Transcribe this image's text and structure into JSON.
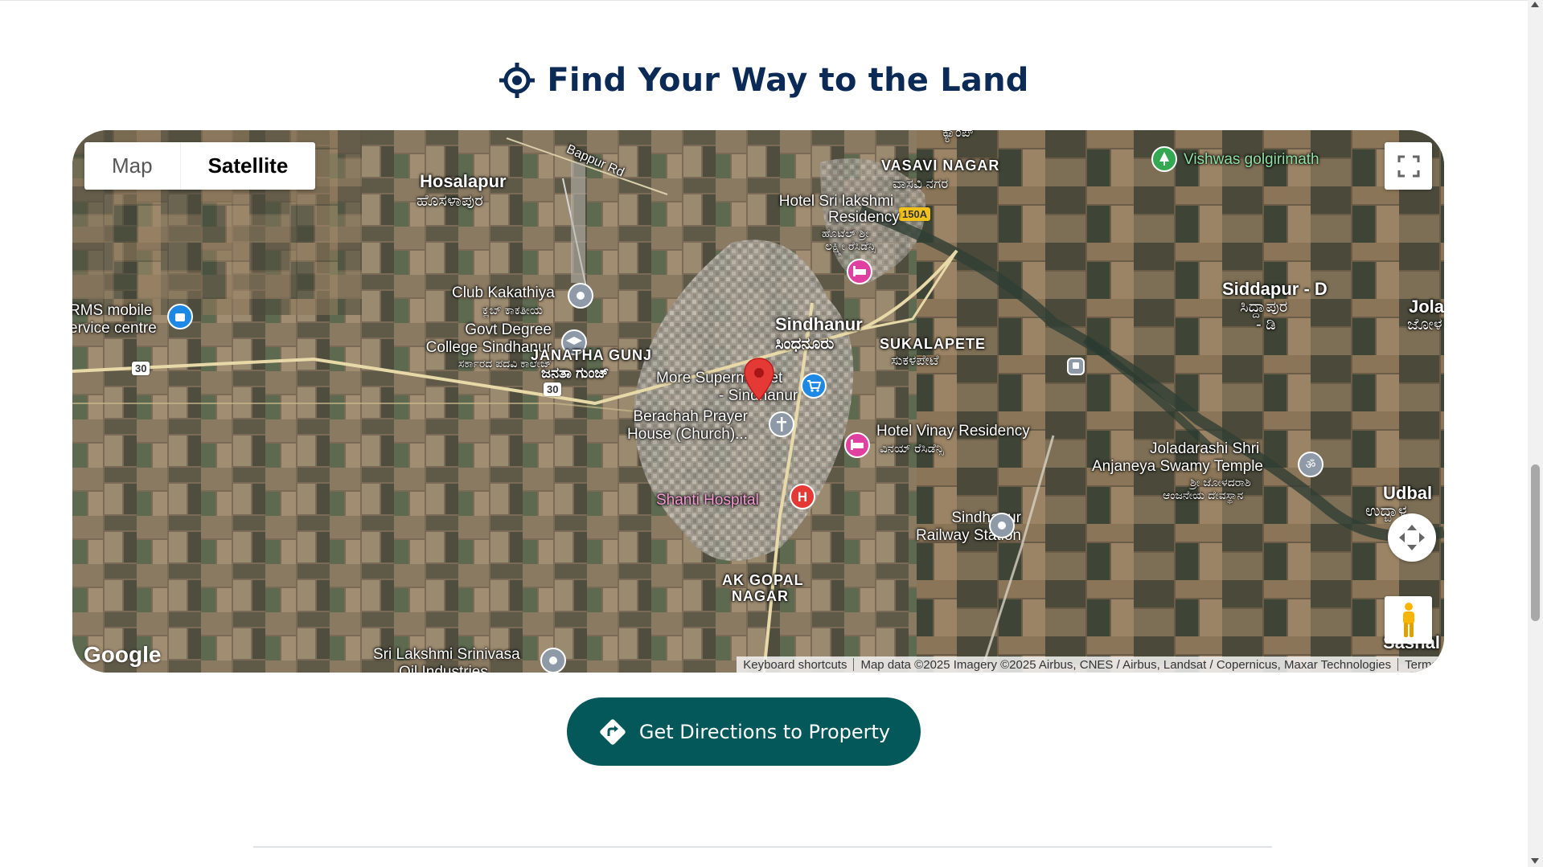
{
  "section": {
    "title": "Find Your Way to the Land",
    "title_icon": "crosshair-location-icon"
  },
  "map": {
    "type_control": {
      "map_label": "Map",
      "satellite_label": "Satellite",
      "selected": "Satellite"
    },
    "fullscreen_icon": "fullscreen-icon",
    "pan_icon": "pan-control-icon",
    "pegman_icon": "street-view-pegman-icon",
    "logo": "Google",
    "attribution": {
      "shortcuts": "Keyboard shortcuts",
      "data": "Map data ©2025 Imagery ©2025 Airbus, CNES / Airbus, Landsat / Copernicus, Maxar Technologies",
      "terms": "Terms"
    },
    "labels": {
      "hosalapur": "Hosalapur",
      "hosalapur_kn": "ಹೊಸಳಾಪುರ",
      "bappur_rd": "Bappur Rd",
      "vasavi_nagar": "VASAVI NAGAR",
      "vasavi_nagar_kn": "ವಾಸವಿ ನಗರ",
      "camp_kn": "ಕ್ಯಾಂಪ್",
      "vishwas": "Vishwas golgirimath",
      "hotel_sri_l1": "Hotel Sri lakshmi",
      "hotel_sri_l2": "Residency",
      "hotel_sri_kn1": "ಹೊಟೆಲ್ ಶ್ರೀ",
      "hotel_sri_kn2": "ಲಕ್ಷ್ಮೀ ರೆಸಿಡೆನ್ಸಿ",
      "club": "Club Kakathiya",
      "club_kn": "ಕ್ಲಬ್ ಕಾಕತೀಯ",
      "rms_l1": "RMS mobile",
      "rms_l2": "ervice centre",
      "govt_l1": "Govt Degree",
      "govt_l2": "College Sindhanur",
      "govt_kn": "ಸರ್ಕಾರದ ಪದವಿ ಕಾಲೇಜ್",
      "janatha": "JANATHA GUNJ",
      "janatha_kn": "ಜನತಾ ಗುಂಜ್",
      "sindhanur": "Sindhanur",
      "sindhanur_kn": "ಸಿಂಧನೂರು",
      "sukalapete": "SUKALAPETE",
      "sukalapete_kn": "ಸುಕಳಪೇಟೆ",
      "siddapur": "Siddapur - D",
      "siddapur_kn1": "ಸಿದ್ದಾಪುರ",
      "siddapur_kn2": "- ಡಿ",
      "jola": "Jola",
      "jola_kn": "ಜೋಳ",
      "more_l1": "More Supermarket",
      "more_l2": "- Sindhanur",
      "berachah_l1": "Berachah Prayer",
      "berachah_l2": "House (Church)...",
      "hotel_vinay": "Hotel Vinay Residency",
      "hotel_vinay_kn": "ವಿನಯ್ ರೆಸಿಡೆನ್ಸಿ",
      "joladarashi_l1": "Joladarashi Shri",
      "joladarashi_l2": "Anjaneya Swamy Temple",
      "joladarashi_kn1": "ಶ್ರೀ ಜೋಳದರಾಶಿ",
      "joladarashi_kn2": "ಆಂಜನೇಯ ದೇವಸ್ಥಾನ",
      "udbal": "Udbal",
      "udbal_kn": "ಉದ್ಬಾಳ",
      "shanti": "Shanti Hospital",
      "railway_l1": "Sindhanur",
      "railway_l2": "Railway Station",
      "akgopal_l1": "AK GOPAL",
      "akgopal_l2": "NAGAR",
      "lakshmi_l1": "Sri Lakshmi Srinivasa",
      "lakshmi_l2": "Oil Industries",
      "sasnal": "Sasnal",
      "road_30": "30",
      "road_150a": "150A"
    }
  },
  "cta": {
    "label": "Get Directions to Property",
    "icon": "directions-turn-icon"
  },
  "colors": {
    "title": "#0b2a55",
    "button": "#05585a",
    "marker": "#e53935",
    "hotel_poi": "#e040a0",
    "hospital_poi": "#e53935",
    "shop_poi": "#1e88e5",
    "generic_poi": "#8e9aa8"
  }
}
